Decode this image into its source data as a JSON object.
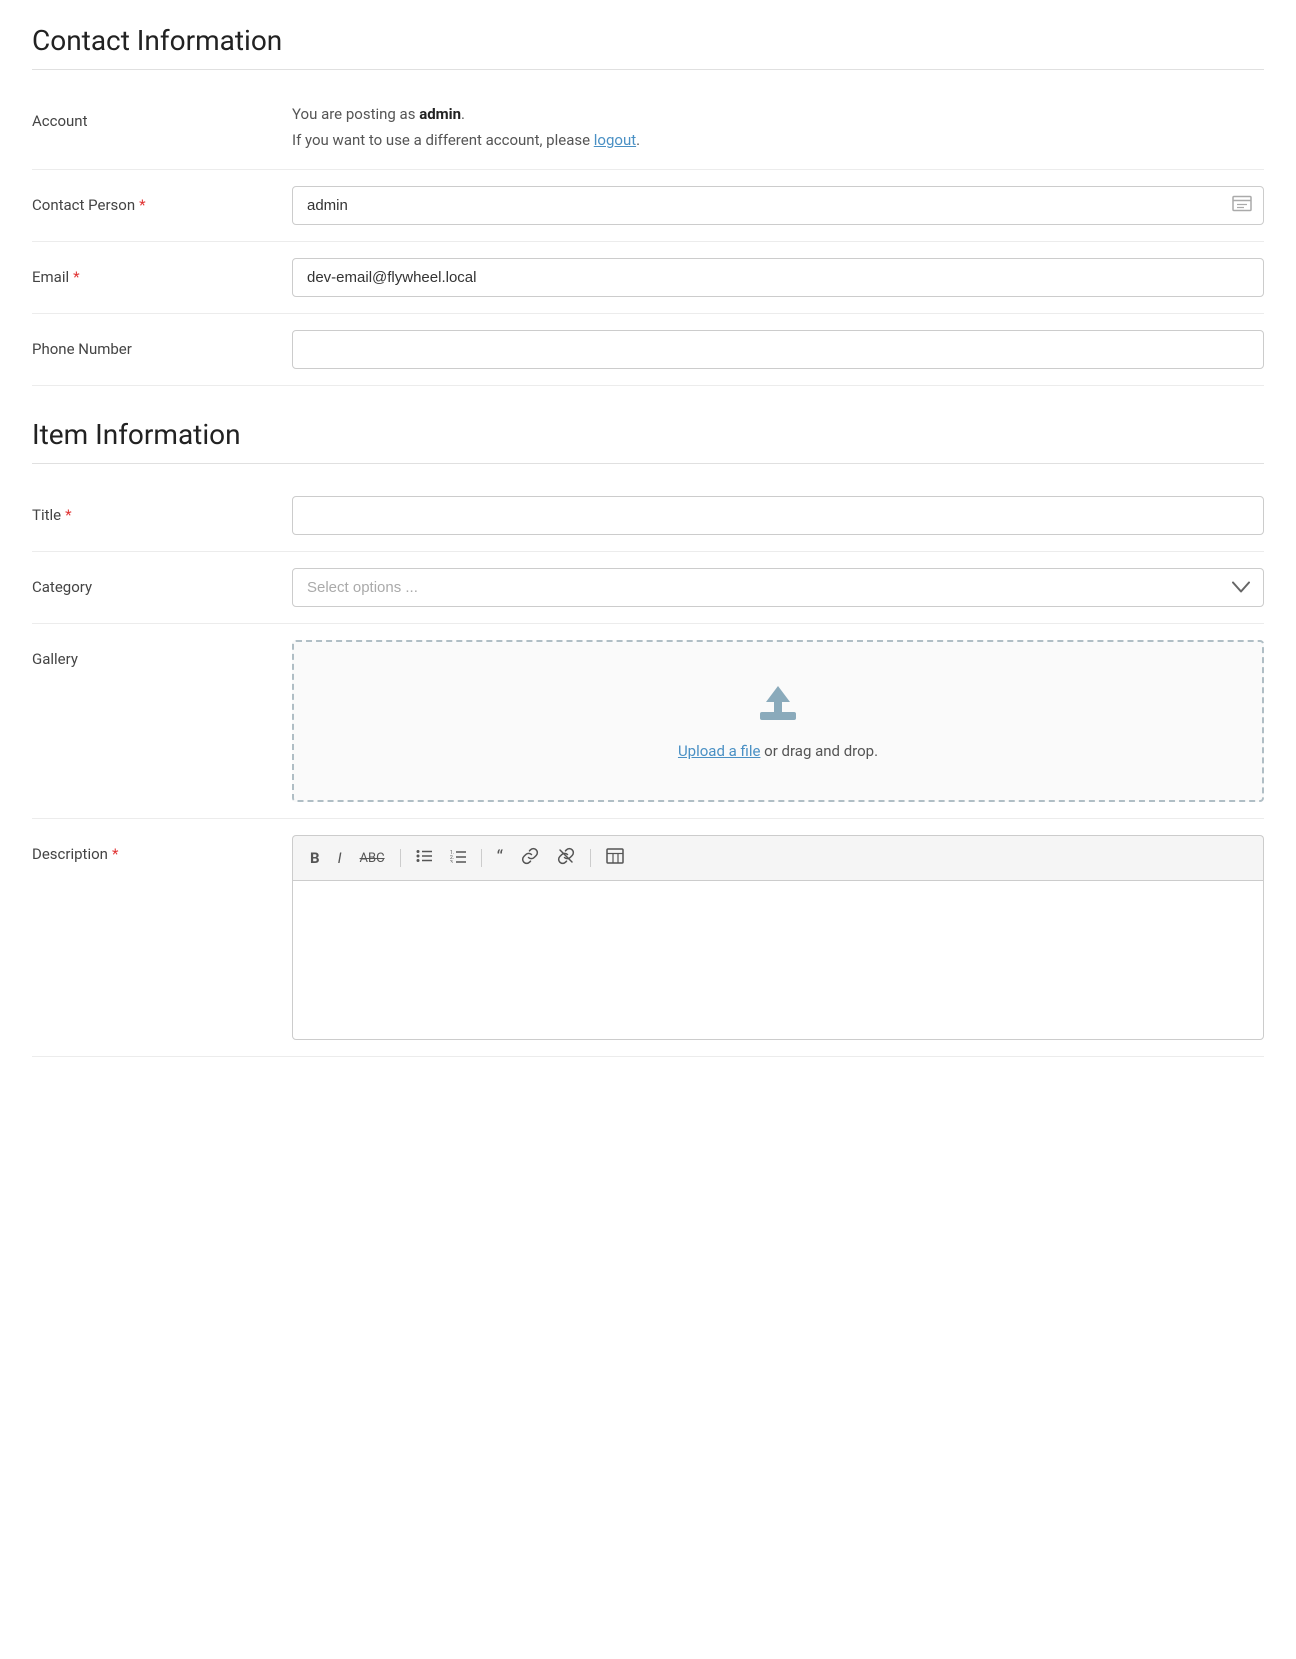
{
  "contact_section": {
    "title": "Contact Information",
    "account_label": "Account",
    "account_text_prefix": "You are posting as ",
    "account_username": "admin",
    "account_text_suffix": ".",
    "account_alt_text": "If you want to use a different account, please ",
    "account_logout_link": "logout",
    "account_alt_suffix": ".",
    "contact_person_label": "Contact Person",
    "contact_person_value": "admin",
    "contact_person_placeholder": "",
    "email_label": "Email",
    "email_value": "dev-email@flywheel.local",
    "email_placeholder": "",
    "phone_label": "Phone Number",
    "phone_value": "",
    "phone_placeholder": ""
  },
  "item_section": {
    "title": "Item Information",
    "title_label": "Title",
    "title_value": "",
    "title_placeholder": "",
    "category_label": "Category",
    "category_placeholder": "Select options ...",
    "gallery_label": "Gallery",
    "gallery_upload_link": "Upload a file",
    "gallery_upload_suffix": " or drag and drop.",
    "description_label": "Description"
  },
  "toolbar": {
    "bold": "B",
    "italic": "I",
    "strikethrough": "ABC",
    "unordered_list": "≡",
    "ordered_list": "≡",
    "blockquote": "❝",
    "link": "🔗",
    "unlink": "⛓",
    "table": "⊞"
  }
}
